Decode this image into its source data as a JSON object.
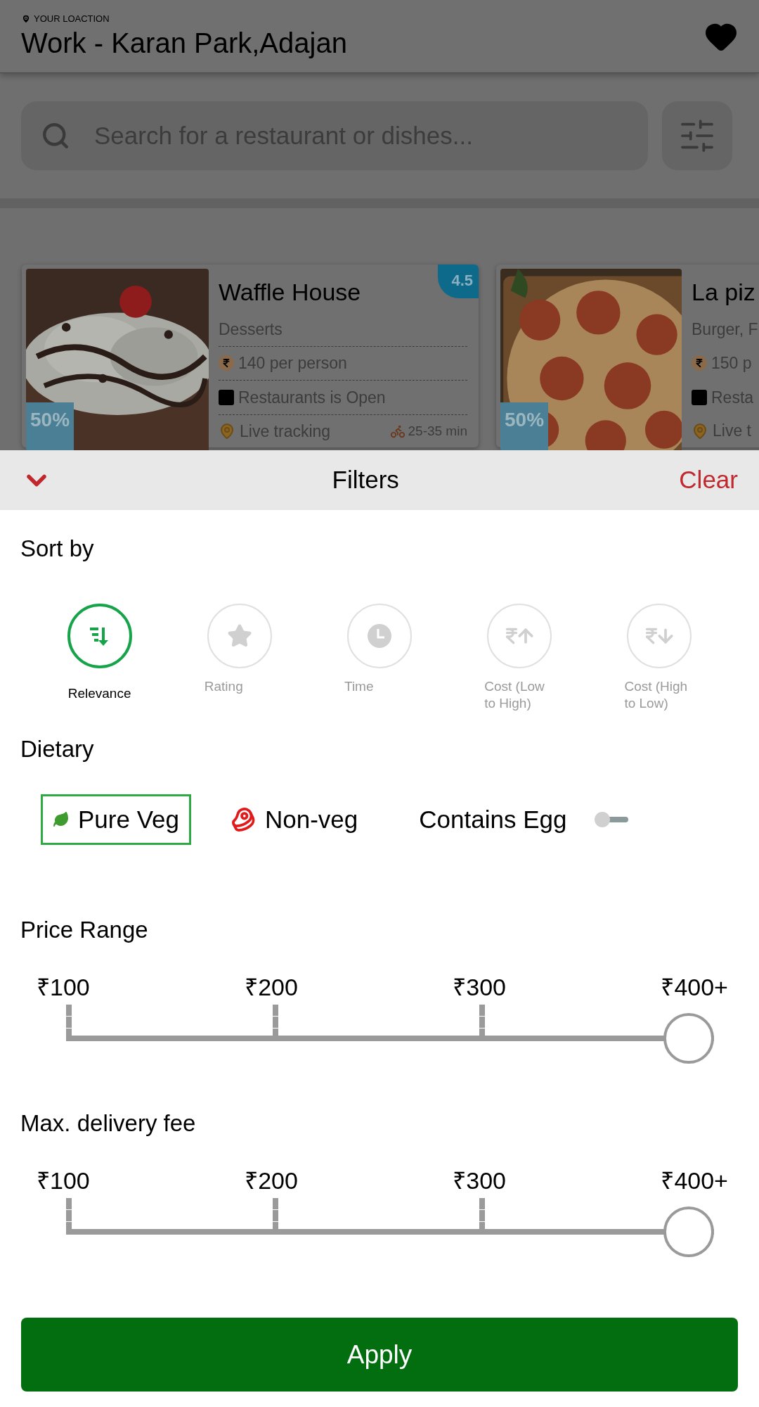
{
  "header": {
    "location_label": "YOUR LOACTION",
    "location": "Work - Karan Park,Adajan"
  },
  "search": {
    "placeholder": "Search for a restaurant or dishes..."
  },
  "restaurants": [
    {
      "name": "Waffle House",
      "rating": "4.5",
      "cuisine": "Desserts",
      "price": "140 per person",
      "status": "Restaurants is Open",
      "tracking": "Live tracking",
      "time": "25-35 min",
      "offer": "50%"
    },
    {
      "name": "La piz",
      "cuisine": "Burger, F",
      "price": "150 p",
      "status": "Resta",
      "tracking": "Live t",
      "offer": "50%"
    }
  ],
  "filters": {
    "title": "Filters",
    "clear": "Clear"
  },
  "sort": {
    "title": "Sort by",
    "options": [
      {
        "kind": "relevance",
        "label": "Relevance",
        "selected": true
      },
      {
        "kind": "rating",
        "label": "Rating",
        "selected": false
      },
      {
        "kind": "time",
        "label": "Time",
        "selected": false
      },
      {
        "kind": "cost_up",
        "label": "Cost (Low to High)",
        "selected": false
      },
      {
        "kind": "cost_down",
        "label": "Cost (High to Low)",
        "selected": false
      }
    ]
  },
  "dietary": {
    "title": "Dietary",
    "options": [
      {
        "kind": "veg",
        "label": "Pure Veg",
        "selected": true
      },
      {
        "kind": "nonveg",
        "label": "Non-veg",
        "selected": false
      }
    ],
    "egg_toggle": {
      "label": "Contains Egg",
      "on": false
    }
  },
  "sliders": [
    {
      "title": "Price Range",
      "ticks": [
        "₹100",
        "₹200",
        "₹300",
        "₹400+"
      ],
      "level": 1
    },
    {
      "title": "Max. delivery fee",
      "ticks": [
        "₹100",
        "₹200",
        "₹300",
        "₹400+"
      ],
      "level": 1
    }
  ],
  "apply_button": "Apply"
}
